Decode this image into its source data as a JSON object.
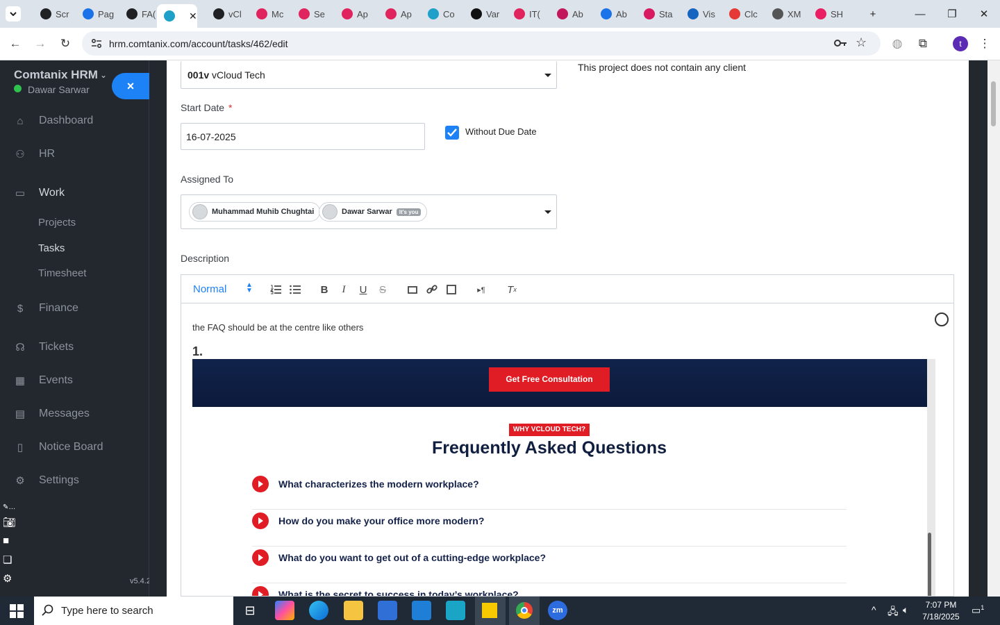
{
  "browser": {
    "tabs": [
      {
        "label": "Scr",
        "color": "#202124"
      },
      {
        "label": "Pag",
        "color": "#1a73e8"
      },
      {
        "label": "FA(",
        "color": "#202124"
      },
      {
        "label": "",
        "color": "#1ea0c8",
        "active": true
      },
      {
        "label": "vCl",
        "color": "#202124"
      },
      {
        "label": "Mc",
        "color": "#e0245e"
      },
      {
        "label": "Se",
        "color": "#e0245e"
      },
      {
        "label": "Ap",
        "color": "#e0245e"
      },
      {
        "label": "Ap",
        "color": "#e0245e"
      },
      {
        "label": "Co",
        "color": "#1ea0c8"
      },
      {
        "label": "Var",
        "color": "#111"
      },
      {
        "label": "IT(",
        "color": "#e0245e"
      },
      {
        "label": "Ab",
        "color": "#c2185b"
      },
      {
        "label": "Ab",
        "color": "#1a73e8"
      },
      {
        "label": "Sta",
        "color": "#d81b60"
      },
      {
        "label": "Vis",
        "color": "#1565c0"
      },
      {
        "label": "Clc",
        "color": "#e53935"
      },
      {
        "label": "XM",
        "color": "#555"
      },
      {
        "label": "SH",
        "color": "#e91e63"
      }
    ],
    "url": "hrm.comtanix.com/account/tasks/462/edit",
    "profile_initial": "t"
  },
  "sidebar": {
    "brand": "Comtanix HRM",
    "user": "Dawar Sarwar",
    "close_label": "×",
    "items": [
      {
        "label": "Dashboard",
        "icon": "home-icon"
      },
      {
        "label": "HR",
        "icon": "users-icon"
      },
      {
        "label": "Work",
        "icon": "briefcase-icon"
      },
      {
        "label": "Finance",
        "icon": "dollar-icon"
      },
      {
        "label": "Tickets",
        "icon": "headset-icon"
      },
      {
        "label": "Events",
        "icon": "calendar-icon"
      },
      {
        "label": "Messages",
        "icon": "message-icon"
      },
      {
        "label": "Notice Board",
        "icon": "clipboard-icon"
      },
      {
        "label": "Settings",
        "icon": "gear-icon"
      }
    ],
    "work_sub": [
      "Projects",
      "Tasks",
      "Timesheet"
    ],
    "version": "v5.4.2"
  },
  "form": {
    "project_code": "001v",
    "project_name": "vCloud Tech",
    "client_note": "This project does not contain any client",
    "start_date_label": "Start Date",
    "required_mark": "*",
    "start_date": "16-07-2025",
    "without_due_label": "Without Due Date",
    "without_due_checked": true,
    "assigned_label": "Assigned To",
    "assignees": [
      {
        "name": "Muhammad Muhib Chughtai",
        "you": ""
      },
      {
        "name": "Dawar Sarwar",
        "you": "It's you"
      }
    ],
    "description_label": "Description"
  },
  "editor": {
    "format": "Normal",
    "text": "the FAQ should be at the centre like others",
    "list_number": "1.",
    "embed": {
      "cta": "Get Free Consultation",
      "badge": "WHY VCLOUD TECH?",
      "heading": "Frequently Asked Questions",
      "questions": [
        "What characterizes the modern workplace?",
        "How do you make your office more modern?",
        "What do you want to get out of a cutting-edge workplace?",
        "What is the secret to success in today’s workplace?"
      ]
    }
  },
  "taskbar": {
    "search_placeholder": "Type here to search",
    "time": "7:07 PM",
    "date": "7/18/2025",
    "notif_count": "1"
  }
}
